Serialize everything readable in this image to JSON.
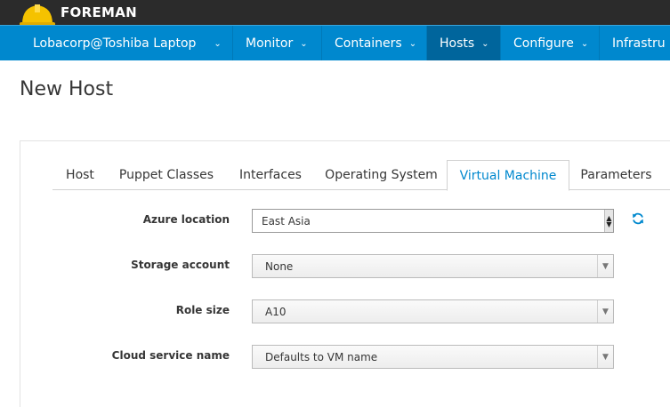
{
  "header": {
    "brand": "FOREMAN",
    "logo_icon": "hard-hat-icon",
    "colors": {
      "topbar": "#2b2b2b",
      "navbar": "#0088ce",
      "navbar_active": "#00659c",
      "helmet": "#f5c200"
    }
  },
  "nav": {
    "items": [
      {
        "label": "Lobacorp@Toshiba Laptop",
        "caret": "⌄"
      },
      {
        "label": "Monitor",
        "caret": "⌄"
      },
      {
        "label": "Containers",
        "caret": "⌄"
      },
      {
        "label": "Hosts",
        "caret": "⌄"
      },
      {
        "label": "Configure",
        "caret": "⌄"
      },
      {
        "label": "Infrastru"
      }
    ],
    "active_index": 3
  },
  "page": {
    "title": "New Host"
  },
  "tabs": {
    "items": [
      "Host",
      "Puppet Classes",
      "Interfaces",
      "Operating System",
      "Virtual Machine",
      "Parameters"
    ],
    "active": "Virtual Machine"
  },
  "form": {
    "azure_location": {
      "label": "Azure location",
      "value": "East Asia"
    },
    "storage_account": {
      "label": "Storage account",
      "value": "None"
    },
    "role_size": {
      "label": "Role size",
      "value": "A10"
    },
    "cloud_service_name": {
      "label": "Cloud service name",
      "value": "Defaults to VM name"
    }
  },
  "icons": {
    "refresh": "refresh-icon"
  }
}
